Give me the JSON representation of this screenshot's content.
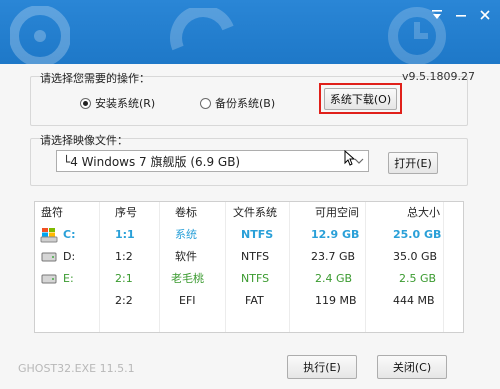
{
  "operation": {
    "heading": "请选择您需要的操作：",
    "version": "v9.5.1809.27",
    "install_label": "安装系统(R)",
    "backup_label": "备份系统(B)",
    "download_label": "系统下载(O)"
  },
  "image": {
    "heading": "请选择映像文件：",
    "selected": "└4 Windows 7 旗舰版 (6.9 GB)",
    "open_label": "打开(E)"
  },
  "table": {
    "headers": [
      "盘符",
      "序号",
      "卷标",
      "文件系统",
      "可用空间",
      "总大小"
    ],
    "rows": [
      {
        "drive": "C:",
        "index": "1:1",
        "label": "系统",
        "fs": "NTFS",
        "free": "12.9 GB",
        "total": "25.0 GB"
      },
      {
        "drive": "D:",
        "index": "1:2",
        "label": "软件",
        "fs": "NTFS",
        "free": "23.7 GB",
        "total": "35.0 GB"
      },
      {
        "drive": "E:",
        "index": "2:1",
        "label": "老毛桃",
        "fs": "NTFS",
        "free": "2.4 GB",
        "total": "2.5 GB"
      },
      {
        "drive": "",
        "index": "2:2",
        "label": "EFI",
        "fs": "FAT",
        "free": "119 MB",
        "total": "444 MB"
      }
    ]
  },
  "footer": {
    "app_version": "GHOST32.EXE 11.5.1",
    "execute_label": "执行(E)",
    "close_label": "关闭(C)"
  },
  "colors": {
    "titlebar": "#1e78c8",
    "highlight_blue": "#2aa0d8",
    "highlight_green": "#3a9a2f",
    "red_outline": "#e0201a"
  }
}
